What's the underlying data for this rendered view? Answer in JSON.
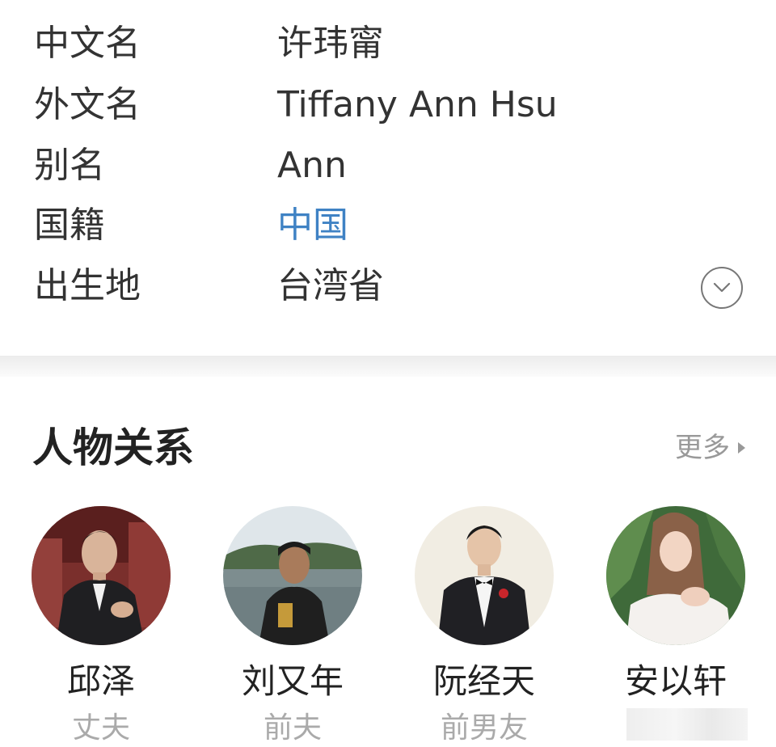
{
  "info": {
    "rows": [
      {
        "label": "中文名",
        "value": "许玮甯"
      },
      {
        "label": "外文名",
        "value": "Tiffany Ann Hsu"
      },
      {
        "label": "别名",
        "value": "Ann"
      },
      {
        "label": "国籍",
        "value": "中国"
      },
      {
        "label": "出生地",
        "value": "台湾省"
      }
    ],
    "link_color": "#3f82c4",
    "expand_icon": "chevron-down-circle-icon"
  },
  "relations": {
    "title": "人物关系",
    "more_label": "更多",
    "people": [
      {
        "name": "邱泽",
        "relation": "丈夫"
      },
      {
        "name": "刘又年",
        "relation": "前夫"
      },
      {
        "name": "阮经天",
        "relation": "前男友"
      },
      {
        "name": "安以轩",
        "relation": ""
      }
    ]
  }
}
